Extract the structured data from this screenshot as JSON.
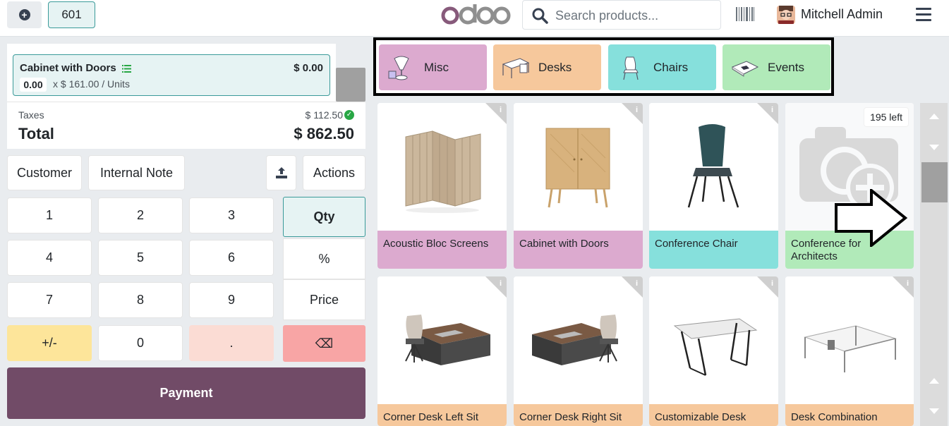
{
  "topbar": {
    "order_number": "601",
    "logo_text": "odoo",
    "search_placeholder": "Search products...",
    "user_name": "Mitchell Admin"
  },
  "orderline": {
    "product_name": "Cabinet with Doors",
    "price": "$ 0.00",
    "quantity": "0.00",
    "unit_price_text": "x $ 161.00 / Units"
  },
  "totals": {
    "taxes_label": "Taxes",
    "taxes_value": "$ 112.50",
    "total_label": "Total",
    "total_value": "$ 862.50"
  },
  "controls": {
    "customer_label": "Customer",
    "internal_note_label": "Internal Note",
    "actions_label": "Actions"
  },
  "numpad": {
    "keys": [
      "1",
      "2",
      "3",
      "4",
      "5",
      "6",
      "7",
      "8",
      "9",
      "+/-",
      "0",
      "."
    ],
    "backspace": "⌫"
  },
  "modes": {
    "qty": "Qty",
    "discount": "%",
    "price": "Price"
  },
  "payment_label": "Payment",
  "categories": [
    {
      "label": "Misc",
      "color": "#dcaacf"
    },
    {
      "label": "Desks",
      "color": "#f6c89c"
    },
    {
      "label": "Chairs",
      "color": "#86e0dc"
    },
    {
      "label": "Events",
      "color": "#b1eab9"
    }
  ],
  "products": [
    {
      "name": "Acoustic Bloc Screens",
      "color": "#dcaacf"
    },
    {
      "name": "Cabinet with Doors",
      "color": "#dcaacf"
    },
    {
      "name": "Conference Chair",
      "color": "#86e0dc"
    },
    {
      "name": "Conference for Architects",
      "color": "#b1eab9",
      "stock": "195 left"
    },
    {
      "name": "Corner Desk Left Sit",
      "color": "#f6c89c"
    },
    {
      "name": "Corner Desk Right Sit",
      "color": "#f6c89c"
    },
    {
      "name": "Customizable Desk",
      "color": "#f6c89c"
    },
    {
      "name": "Desk Combination",
      "color": "#f6c89c"
    }
  ],
  "colors": {
    "primary": "#714b67",
    "accent_teal": "#3a9a99",
    "backspace_red": "#f8a5a5",
    "plusminus_yellow": "#fde59a",
    "dot_pink": "#fbdcd4"
  }
}
